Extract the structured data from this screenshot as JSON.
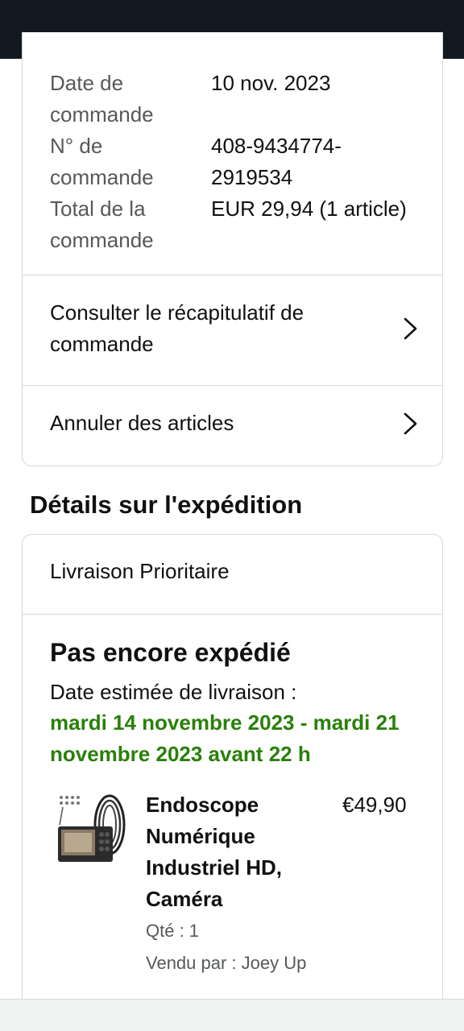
{
  "order": {
    "date_label": "Date de commande",
    "date_value": "10 nov. 2023",
    "number_label": "N° de commande",
    "number_value": "408-9434774-2919534",
    "total_label": "Total de la commande",
    "total_value": "EUR 29,94 (1 article)"
  },
  "links": {
    "summary": "Consulter le récapitulatif de commande",
    "cancel": "Annuler des articles"
  },
  "shipping": {
    "section_title": "Détails sur l'expédition",
    "method": "Livraison Prioritaire",
    "status": "Pas encore expédié",
    "estimate_label": "Date estimée de livraison :",
    "estimate_date": "mardi 14 novembre 2023 - mardi 21 novembre 2023 avant 22 h"
  },
  "product": {
    "title": "Endoscope Numérique Industriel HD, Caméra",
    "price": "€49,90",
    "qty": "Qté : 1",
    "seller": "Vendu par : Joey Up"
  },
  "colors": {
    "header": "#131921",
    "delivery_green": "#2a8009",
    "secondary_text": "#565959"
  }
}
